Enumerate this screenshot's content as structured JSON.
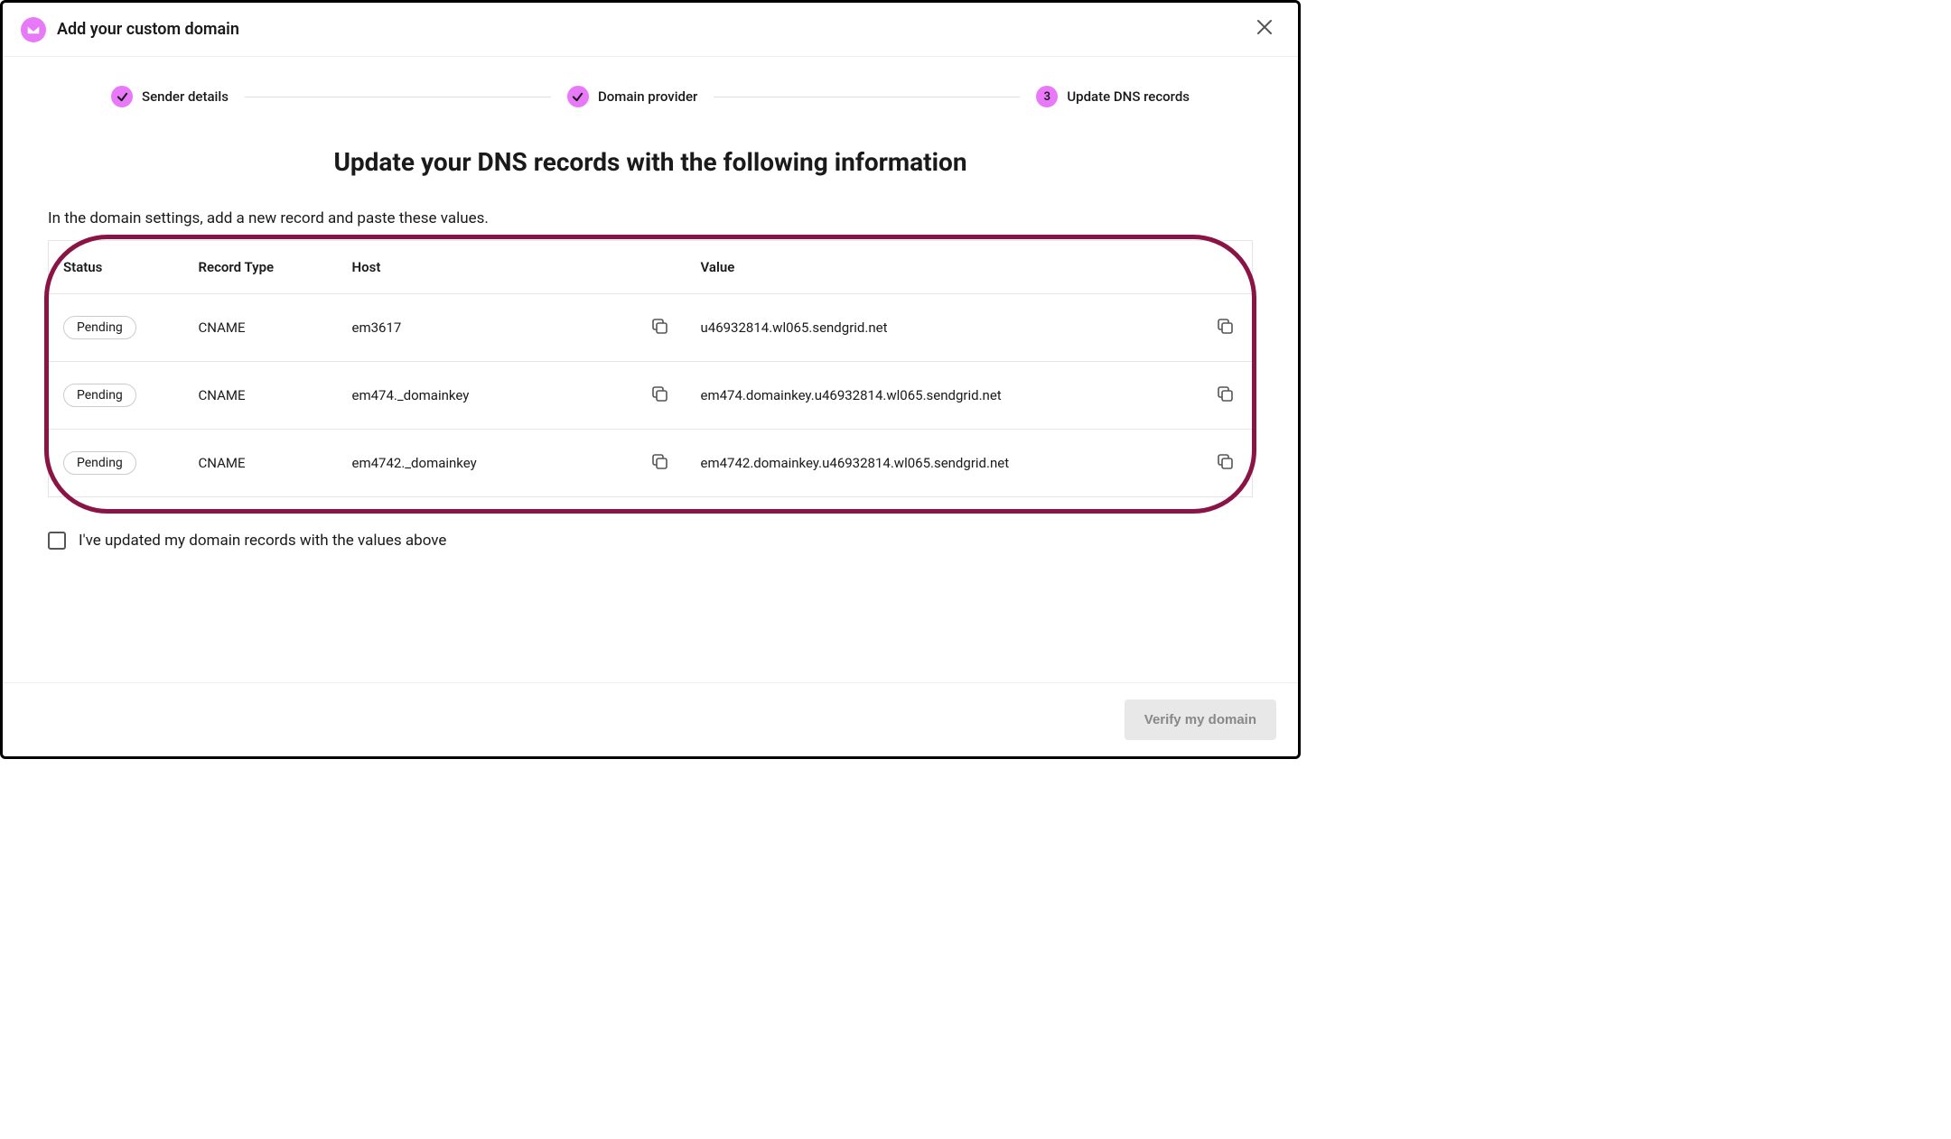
{
  "header": {
    "title": "Add your custom domain"
  },
  "stepper": {
    "steps": [
      {
        "label": "Sender details",
        "badge": "✓"
      },
      {
        "label": "Domain provider",
        "badge": "✓"
      },
      {
        "label": "Update DNS records",
        "badge": "3"
      }
    ]
  },
  "main": {
    "title": "Update your DNS records with the following information",
    "instruction": "In the domain settings, add a new record and paste these values."
  },
  "table": {
    "headers": {
      "status": "Status",
      "type": "Record Type",
      "host": "Host",
      "value": "Value"
    },
    "rows": [
      {
        "status": "Pending",
        "type": "CNAME",
        "host": "em3617",
        "value": "u46932814.wl065.sendgrid.net"
      },
      {
        "status": "Pending",
        "type": "CNAME",
        "host": "em474._domainkey",
        "value": "em474.domainkey.u46932814.wl065.sendgrid.net"
      },
      {
        "status": "Pending",
        "type": "CNAME",
        "host": "em4742._domainkey",
        "value": "em4742.domainkey.u46932814.wl065.sendgrid.net"
      }
    ]
  },
  "confirm": {
    "label": "I've updated my domain records with the values above"
  },
  "footer": {
    "verify": "Verify my domain"
  }
}
